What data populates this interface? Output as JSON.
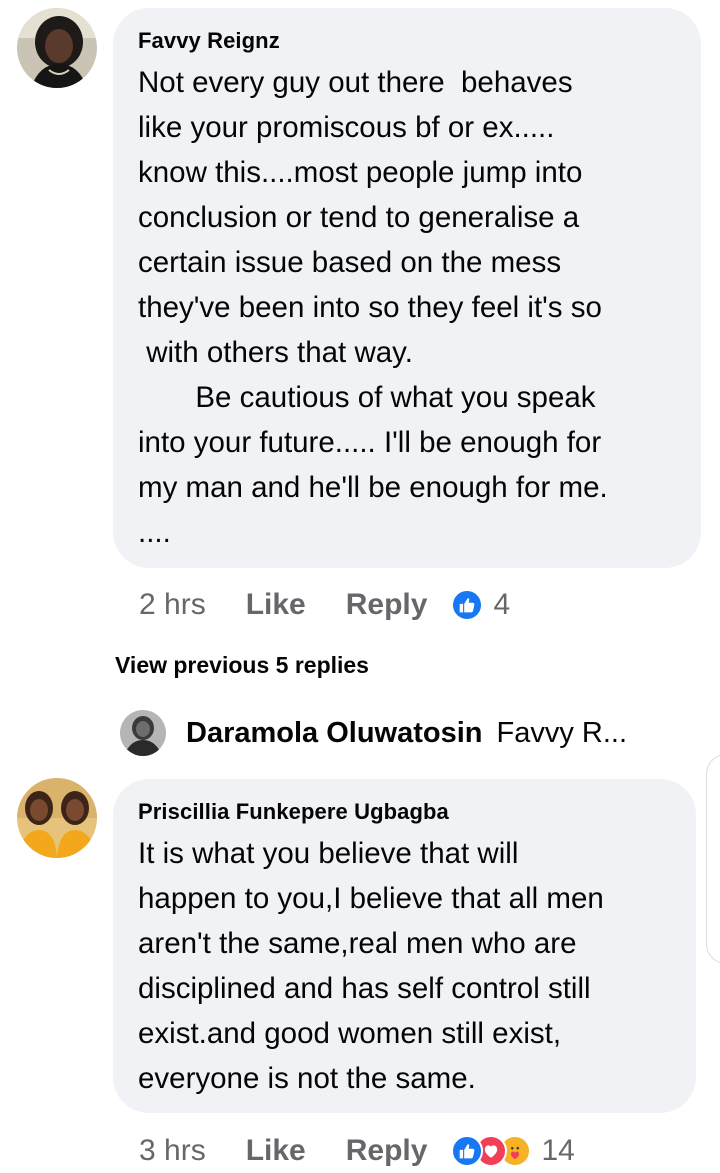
{
  "comments": [
    {
      "author": "Favvy Reignz",
      "text": "Not every guy out there  behaves\nlike your promiscous bf or ex.....\nknow this....most people jump into\nconclusion or tend to generalise a\ncertain issue based on the mess\nthey've been into so they feel it's so\n with others that way.\n       Be cautious of what you speak\ninto your future..... I'll be enough for\nmy man and he'll be enough for me.\n....",
      "time": "2 hrs",
      "like_label": "Like",
      "reply_label": "Reply",
      "reaction_count": "4",
      "reactions": [
        "like-icon"
      ]
    },
    {
      "author": "Priscillia Funkepere Ugbagba",
      "text": "It is what you believe that will\nhappen to you,I believe that all men\naren't the same,real men who are\ndisciplined and has self control still\nexist.and good women still exist,\neveryone is not the same.",
      "time": "3 hrs",
      "like_label": "Like",
      "reply_label": "Reply",
      "reaction_count": "14",
      "reactions": [
        "like-icon",
        "love-icon",
        "care-icon"
      ]
    }
  ],
  "view_previous": "View previous 5 replies",
  "reply_preview": {
    "name": "Daramola Oluwatosin",
    "snippet": "Favvy R..."
  },
  "colors": {
    "bubble": "#f0f2f5",
    "meta": "#65676b",
    "like_blue": "#1877f2",
    "love_red": "#f33e58",
    "care_yellow": "#f7b125"
  }
}
